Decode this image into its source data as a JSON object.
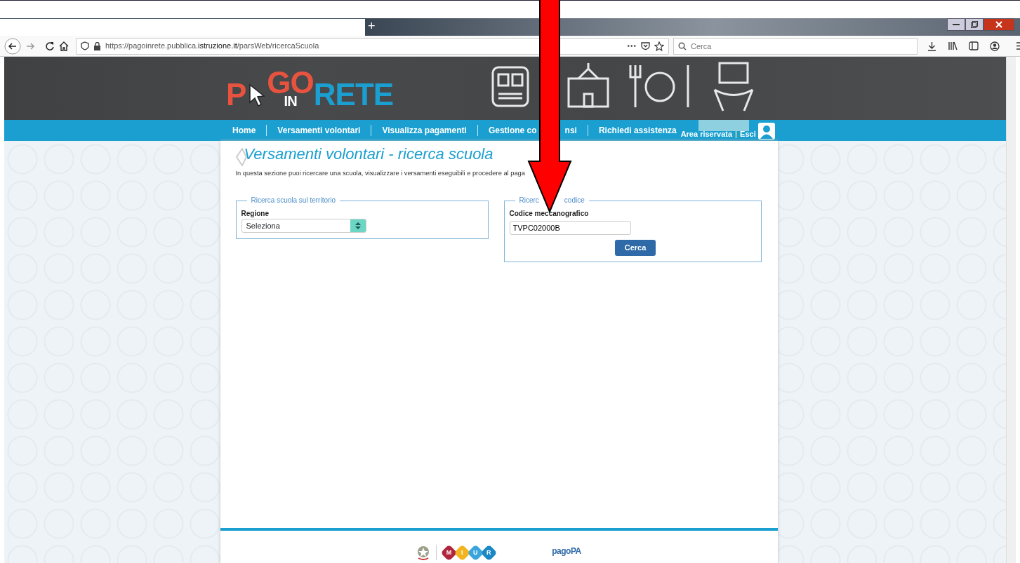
{
  "browser": {
    "new_tab": "+",
    "url": "https://pagoinrete.pubblica.**istruzione.it**/parsWeb/ricercaScuola",
    "page_actions": "•••",
    "search": {
      "placeholder": "Cerca"
    }
  },
  "logo": {
    "letters": [
      {
        "kind": "big",
        "text": "P",
        "color": "#e8533f"
      },
      {
        "kind": "big",
        "text": "GO",
        "color": "#e8533f"
      },
      {
        "kind": "small",
        "text": "IN",
        "color": "#ffffff"
      },
      {
        "kind": "big",
        "text": "R",
        "color": "#1a9fd0"
      },
      {
        "kind": "big",
        "text": "ETE",
        "color": "#1a9fd0"
      }
    ]
  },
  "nav": {
    "items": [
      {
        "label": "Home"
      },
      {
        "label": "Versamenti volontari"
      },
      {
        "label": "Visualizza pagamenti"
      },
      {
        "label": "Gestione co",
        "label_after": "nsi"
      },
      {
        "label": "Richiedi assistenza"
      }
    ],
    "user": {
      "area": "Area riservata",
      "separator": "|",
      "logout": "Esci"
    }
  },
  "page": {
    "title": "Versamenti volontari - ricerca scuola",
    "description": "In questa sezione puoi ricercare una scuola, visualizzare i versamenti eseguibili e procedere al paga",
    "fieldsets": [
      {
        "kind": "select",
        "legend": "Ricerca scuola sul territorio",
        "label": "Regione",
        "value": "Seleziona"
      },
      {
        "kind": "text",
        "legend": "Ricerc",
        "legend_after": "codice",
        "label": "Codice me",
        "label_after": "ccanografico",
        "value": "TVPC02000B",
        "button": "Cerca"
      }
    ]
  },
  "footer": {
    "miur_letters": [
      {
        "text": "M",
        "color": "#b0253c"
      },
      {
        "text": "I",
        "color": "#f2b420"
      },
      {
        "text": "U",
        "color": "#3aa4dd"
      },
      {
        "text": "R",
        "color": "#1a88c4"
      }
    ],
    "pagopa": "pagoPA"
  }
}
